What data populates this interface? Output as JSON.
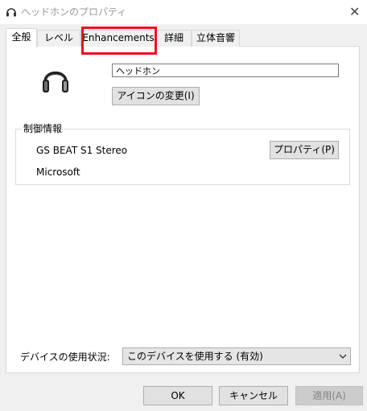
{
  "window": {
    "title": "ヘッドホンのプロパティ",
    "icon": "headphone-icon",
    "close_label": "✕"
  },
  "tabs": [
    {
      "label": "全般",
      "active": true
    },
    {
      "label": "レベル",
      "active": false
    },
    {
      "label": "Enhancements",
      "active": false,
      "highlighted": true
    },
    {
      "label": "詳細",
      "active": false
    },
    {
      "label": "立体音響",
      "active": false
    }
  ],
  "general": {
    "device_name": "ヘッドホン",
    "change_icon_label": "アイコンの変更(I)",
    "controller": {
      "group_label": "制御情報",
      "name": "GS BEAT S1 Stereo",
      "manufacturer": "Microsoft",
      "properties_label": "プロパティ(P)"
    },
    "usage": {
      "label": "デバイスの使用状況:",
      "selected": "このデバイスを使用する (有効)"
    }
  },
  "footer": {
    "ok_label": "OK",
    "cancel_label": "キャンセル",
    "apply_label": "適用(A)"
  },
  "colors": {
    "highlight": "#e81123",
    "panel_bg": "#ffffff",
    "window_bg": "#f0f0f0"
  }
}
